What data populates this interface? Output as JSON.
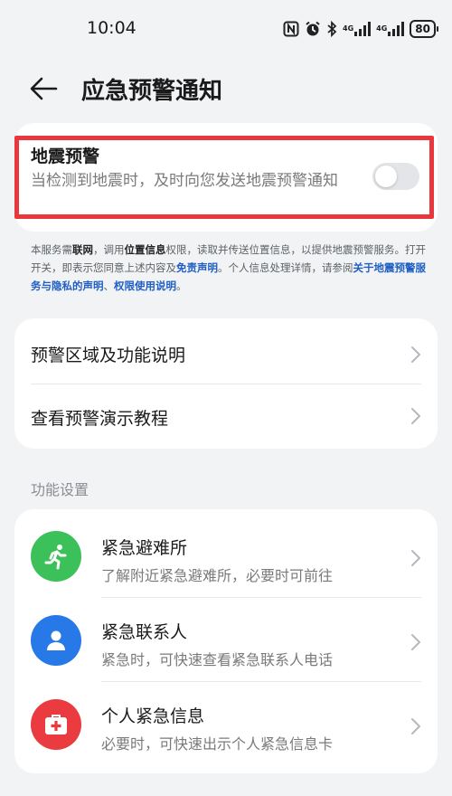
{
  "status": {
    "time": "10:04",
    "network_1": "4G",
    "network_2": "4G",
    "battery": "80",
    "icons": [
      "nfc-icon",
      "alarm-icon",
      "bluetooth-icon",
      "signal-icon",
      "signal-icon",
      "battery-icon"
    ]
  },
  "header": {
    "title": "应急预警通知",
    "back_icon": "back-arrow-icon"
  },
  "earthquake": {
    "title": "地震预警",
    "description": "当检测到地震时，及时向您发送地震预警通知",
    "toggle_on": false,
    "highlight_color": "#e8383d"
  },
  "notice": {
    "p1": "本服务需",
    "b1": "联网",
    "p2": "，调用",
    "b2": "位置信息",
    "p3": "权限，读取并传送位置信息，以提供地震预警服务。打开开关，即表示您同意上述内容及",
    "link1": "免责声明",
    "p4": "。个人信息处理详情，请参阅",
    "link2": "关于地震预警服务与隐私的声明",
    "p5": "、",
    "link3": "权限使用说明",
    "p6": "。",
    "link_color": "#1f5fc4"
  },
  "menu": {
    "items": [
      {
        "label": "预警区域及功能说明"
      },
      {
        "label": "查看预警演示教程"
      }
    ]
  },
  "function_settings": {
    "section_label": "功能设置",
    "items": [
      {
        "title": "紧急避难所",
        "description": "了解附近紧急避难所，必要时可前往",
        "icon": "running-person-icon",
        "color": "#3cc15a"
      },
      {
        "title": "紧急联系人",
        "description": "紧急时，可快速查看紧急联系人电话",
        "icon": "person-icon",
        "color": "#2779e8"
      },
      {
        "title": "个人紧急信息",
        "description": "必要时，可快速出示个人紧急信息卡",
        "icon": "medical-card-icon",
        "color": "#ea3b40"
      }
    ]
  }
}
